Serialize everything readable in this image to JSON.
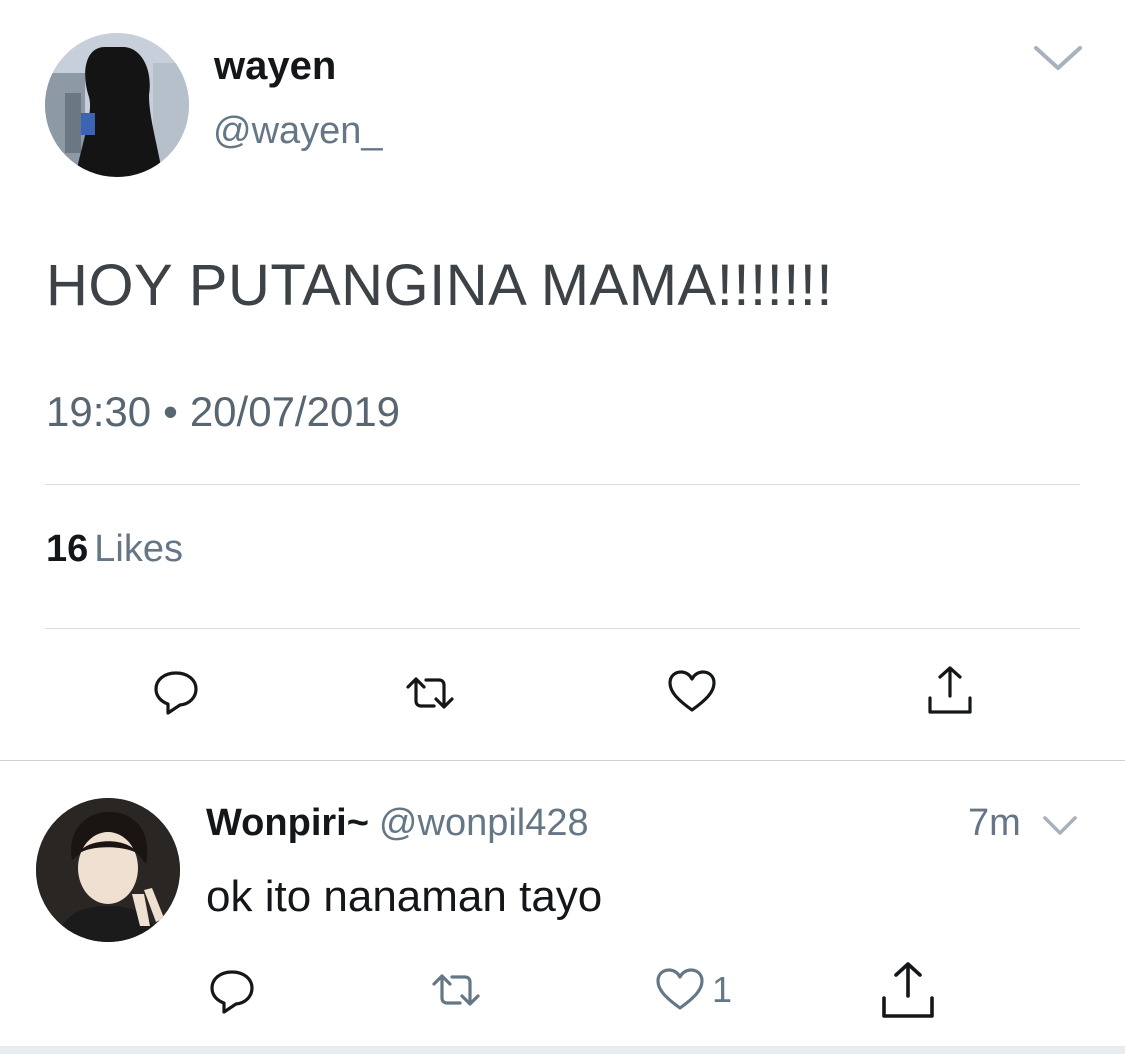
{
  "main_tweet": {
    "author_name": "wayen",
    "author_handle": "@wayen_",
    "text": "HOY PUTANGINA MAMA!!!!!!!",
    "time": "19:30",
    "separator": "•",
    "date": "20/07/2019",
    "likes_count": "16",
    "likes_label": "Likes",
    "avatar_icon": "profile-photo-silhouette",
    "menu_icon": "chevron-down-icon",
    "actions": [
      "reply-icon",
      "retweet-icon",
      "like-icon",
      "share-icon"
    ]
  },
  "reply_tweet": {
    "author_name": "Wonpiri~",
    "author_handle": "@wonpil428",
    "time_ago": "7m",
    "text": "ok ito nanaman tayo",
    "like_count": "1",
    "avatar_icon": "profile-photo-person",
    "menu_icon": "chevron-down-icon",
    "actions": [
      "reply-icon",
      "retweet-icon",
      "like-icon",
      "share-icon"
    ]
  },
  "colors": {
    "text_primary": "#14171a",
    "text_secondary": "#657786",
    "icon_gray": "#657786",
    "divider": "#d8dde1"
  }
}
